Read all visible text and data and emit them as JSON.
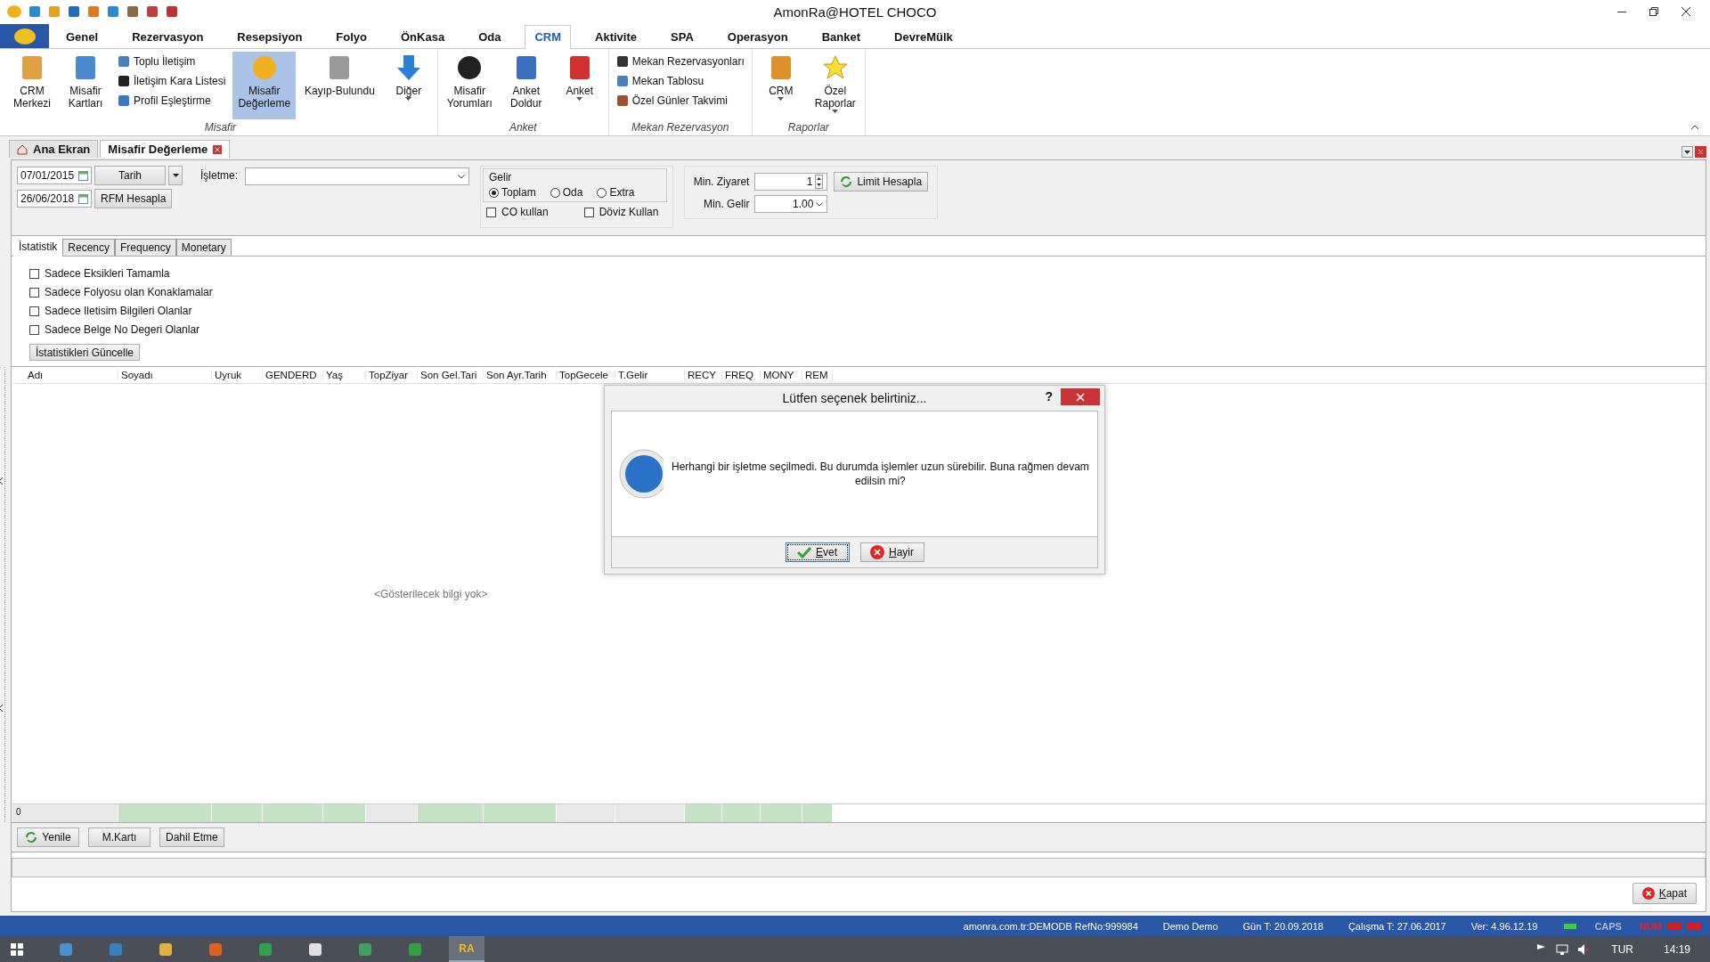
{
  "window": {
    "title": "AmonRa@HOTEL CHOCO"
  },
  "ribbon_tabs": [
    {
      "label": "Genel",
      "selected": false
    },
    {
      "label": "Rezervasyon",
      "selected": false
    },
    {
      "label": "Resepsiyon",
      "selected": false
    },
    {
      "label": "Folyo",
      "selected": false
    },
    {
      "label": "ÖnKasa",
      "selected": false
    },
    {
      "label": "Oda",
      "selected": false
    },
    {
      "label": "CRM",
      "selected": true
    },
    {
      "label": "Aktivite",
      "selected": false
    },
    {
      "label": "SPA",
      "selected": false
    },
    {
      "label": "Operasyon",
      "selected": false
    },
    {
      "label": "Banket",
      "selected": false
    },
    {
      "label": "DevreMülk",
      "selected": false
    }
  ],
  "ribbon_groups": [
    {
      "title": "Misafir",
      "items": [
        {
          "kind": "large",
          "lines": [
            "CRM",
            "Merkezi"
          ],
          "selected": false
        },
        {
          "kind": "large",
          "lines": [
            "Misafir",
            "Kartları"
          ],
          "selected": false
        },
        {
          "kind": "stack",
          "entries": [
            "Toplu İletişim",
            "İletişim Kara Listesi",
            "Profil Eşleştirme"
          ]
        },
        {
          "kind": "large",
          "lines": [
            "Misafir",
            "Değerleme"
          ],
          "selected": true
        },
        {
          "kind": "large",
          "lines": [
            "Kayıp-Bulundu"
          ],
          "selected": false
        },
        {
          "kind": "menu",
          "lines": [
            "Diğer"
          ],
          "selected": false
        }
      ]
    },
    {
      "title": "Anket",
      "items": [
        {
          "kind": "large",
          "lines": [
            "Misafir",
            "Yorumları"
          ],
          "selected": false
        },
        {
          "kind": "large",
          "lines": [
            "Anket",
            "Doldur"
          ],
          "selected": false
        },
        {
          "kind": "menu",
          "lines": [
            "Anket"
          ],
          "selected": false
        }
      ]
    },
    {
      "title": "Mekan Rezervasyon",
      "items": [
        {
          "kind": "stack",
          "entries": [
            "Mekan Rezervasyonları",
            "Mekan Tablosu",
            "Özel Günler Takvimi"
          ]
        }
      ]
    },
    {
      "title": "Raporlar",
      "items": [
        {
          "kind": "menu",
          "lines": [
            "CRM"
          ],
          "selected": false
        },
        {
          "kind": "menu",
          "lines": [
            "Özel",
            "Raporlar"
          ],
          "selected": false
        }
      ]
    }
  ],
  "doc_tabs": [
    {
      "label": "Ana Ekran",
      "selected": false,
      "kind": "home"
    },
    {
      "label": "Misafir Değerleme",
      "selected": true,
      "kind": "document"
    }
  ],
  "filters": {
    "date_from": "07/01/2015",
    "date_to": "26/06/2018",
    "date_button": "Tarih",
    "rfm_button": "RFM Hesapla",
    "isletme_label": "İşletme:",
    "gelir": {
      "title": "Gelir",
      "options": [
        {
          "label": "Toplam",
          "selected": true
        },
        {
          "label": "Oda",
          "selected": false
        },
        {
          "label": "Extra",
          "selected": false
        }
      ],
      "checks": [
        {
          "label": "CO kullan",
          "checked": false
        },
        {
          "label": "Döviz Kullan",
          "checked": false
        }
      ]
    },
    "min_ziyaret_label": "Min. Ziyaret",
    "min_ziyaret": "1",
    "min_gelir_label": "Min. Gelir",
    "min_gelir": "1.00",
    "limit_button": "Limit Hesapla"
  },
  "inner_tabs": [
    {
      "label": "İstatistik",
      "selected": true
    },
    {
      "label": "Recency",
      "selected": false
    },
    {
      "label": "Frequency",
      "selected": false
    },
    {
      "label": "Monetary",
      "selected": false
    }
  ],
  "stat_options": [
    {
      "label": "Sadece Eksikleri Tamamla",
      "checked": false
    },
    {
      "label": "Sadece Folyosu olan Konaklamalar",
      "checked": false
    },
    {
      "label": "Sadece Iletisim Bilgileri Olanlar",
      "checked": false
    },
    {
      "label": "Sadece Belge No Degeri Olanlar",
      "checked": false
    }
  ],
  "update_button": "İstatistikleri Güncelle",
  "table": {
    "columns": [
      {
        "label": "Adı",
        "totals": false
      },
      {
        "label": "Soyadı",
        "totals": true
      },
      {
        "label": "Uyruk",
        "totals": true
      },
      {
        "label": "GENDERD",
        "totals": true
      },
      {
        "label": "Yaş",
        "totals": true
      },
      {
        "label": "TopZiyar",
        "totals": false
      },
      {
        "label": "Son Gel.Tari",
        "totals": true
      },
      {
        "label": "Son Ayr.Tarih",
        "totals": true
      },
      {
        "label": "TopGecele",
        "totals": false
      },
      {
        "label": "T.Gelir",
        "totals": false
      },
      {
        "label": "RECY",
        "totals": true
      },
      {
        "label": "FREQ",
        "totals": true
      },
      {
        "label": "MONY",
        "totals": true
      },
      {
        "label": "REM",
        "totals": true
      }
    ],
    "empty_text": "<Gösterilecek bilgi yok>",
    "count": "0"
  },
  "bottom_buttons": [
    {
      "label": "Yenile",
      "kind": "refresh"
    },
    {
      "label": "M.Kartı",
      "kind": "plain"
    },
    {
      "label": "Dahil Etme",
      "kind": "plain"
    }
  ],
  "close_button": "Kapat",
  "dialog": {
    "title": "Lütfen seçenek belirtiniz...",
    "help": "?",
    "message": "Herhangi bir işletme seçilmedi. Bu durumda işlemler uzun sürebilir. Buna rağmen devam edilsin mi?",
    "buttons": [
      {
        "label": "Evet",
        "kind": "yes",
        "focused": true
      },
      {
        "label": "Hayir",
        "kind": "no",
        "focused": false
      }
    ]
  },
  "status_bar": {
    "items": [
      "amonra.com.tr:DEMODB RefNo:999984",
      "Demo Demo",
      "Gün T: 20.09.2018",
      "Çalışma T: 27.06.2017",
      "Ver: 4.96.12.19"
    ],
    "indicators": [
      {
        "label": "CAPS",
        "on": false
      },
      {
        "label": "NUM",
        "on": true
      }
    ]
  },
  "taskbar": {
    "language": "TUR",
    "time": "14:19",
    "app_label": "RA"
  }
}
